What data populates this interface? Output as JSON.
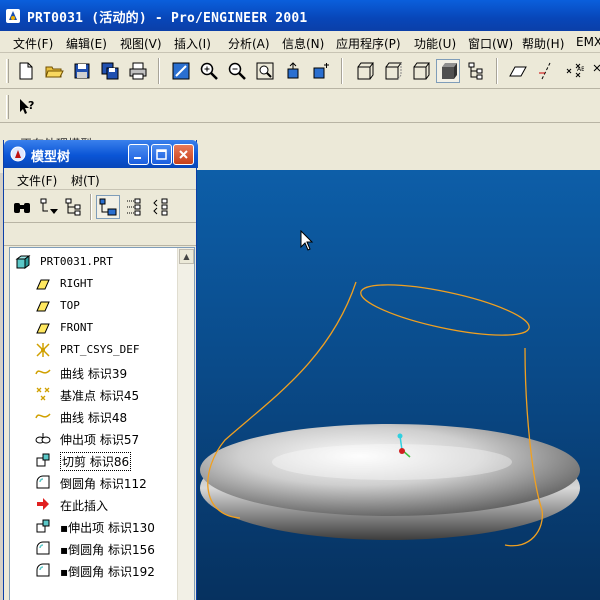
{
  "window": {
    "title": "PRT0031 (活动的) - Pro/ENGINEER 2001"
  },
  "menu": [
    "文件(F)",
    "编辑(E)",
    "视图(V)",
    "插入(I)",
    "分析(A)",
    "信息(N)",
    "应用程序(P)",
    "功能(U)",
    "窗口(W)",
    "帮助(H)",
    "EMX"
  ],
  "status": {
    "message": "正在处理模型"
  },
  "model_tree": {
    "title": "模型树",
    "menu": [
      "文件(F)",
      "树(T)"
    ],
    "root": "PRT0031.PRT",
    "items": [
      {
        "icon": "datum-plane-icon",
        "label": "RIGHT"
      },
      {
        "icon": "datum-plane-icon",
        "label": "TOP"
      },
      {
        "icon": "datum-plane-icon",
        "label": "FRONT"
      },
      {
        "icon": "coordinate-system-icon",
        "label": "PRT_CSYS_DEF"
      },
      {
        "icon": "curve-icon",
        "label": "曲线 标识39"
      },
      {
        "icon": "datum-point-icon",
        "label": "基准点 标识45"
      },
      {
        "icon": "curve-icon",
        "label": "曲线 标识48"
      },
      {
        "icon": "protrusion-icon",
        "label": "伸出项 标识57"
      },
      {
        "icon": "cut-icon",
        "label": "切剪 标识86"
      },
      {
        "icon": "round-icon",
        "label": "倒圆角 标识112"
      },
      {
        "icon": "insert-here-arrow-icon",
        "label": "在此插入"
      },
      {
        "icon": "cut-icon",
        "label": "▪伸出项 标识130"
      },
      {
        "icon": "round-icon",
        "label": "▪倒圆角 标识156"
      },
      {
        "icon": "round-icon",
        "label": "▪倒圆角 标识192"
      }
    ]
  },
  "colors": {
    "titlebar": "#0846b8",
    "viewport_top": "#0d5ea8",
    "viewport_bottom": "#06315f",
    "curve": "#f0a020"
  }
}
